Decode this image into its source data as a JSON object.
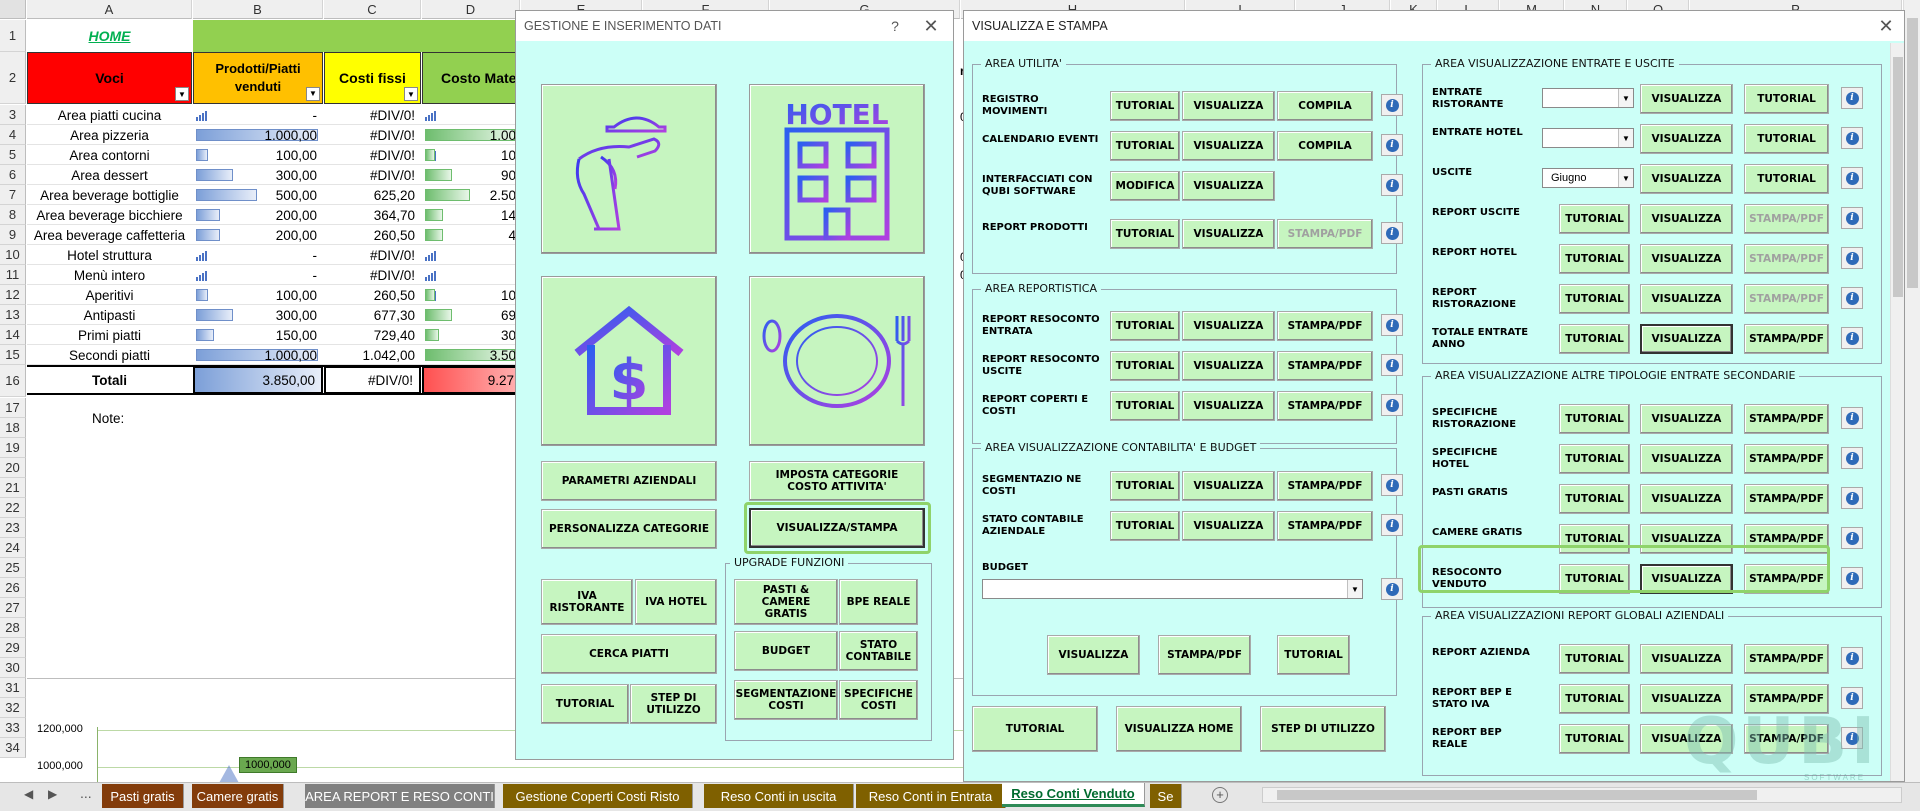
{
  "sheet": {
    "columns": [
      "A",
      "B",
      "C",
      "D",
      "E",
      "F",
      "G",
      "H",
      "I",
      "J",
      "K",
      "L",
      "M",
      "N",
      "O",
      "P"
    ],
    "home_link": "HOME",
    "headers": {
      "voci": "Voci",
      "prodotti": "Prodotti/Piatti venduti",
      "costi_fissi": "Costi fissi",
      "costo_mat": "Costo Mater"
    },
    "rows": [
      {
        "n": "3",
        "voce": "Area piatti cucina",
        "b": "-",
        "c": "#DIV/0!",
        "d": ""
      },
      {
        "n": "4",
        "voce": "Area pizzeria",
        "b": "1.000,00",
        "c": "#DIV/0!",
        "d": "1.00"
      },
      {
        "n": "5",
        "voce": "Area contorni",
        "b": "100,00",
        "c": "#DIV/0!",
        "d": "10"
      },
      {
        "n": "6",
        "voce": "Area dessert",
        "b": "300,00",
        "c": "#DIV/0!",
        "d": "90"
      },
      {
        "n": "7",
        "voce": "Area beverage bottiglie",
        "b": "500,00",
        "c": "625,20",
        "d": "2.50"
      },
      {
        "n": "8",
        "voce": "Area beverage bicchiere",
        "b": "200,00",
        "c": "364,70",
        "d": "14"
      },
      {
        "n": "9",
        "voce": "Area beverage caffetteria",
        "b": "200,00",
        "c": "260,50",
        "d": "4"
      },
      {
        "n": "10",
        "voce": "Hotel struttura",
        "b": "-",
        "c": "#DIV/0!",
        "d": ""
      },
      {
        "n": "11",
        "voce": "Menù intero",
        "b": "-",
        "c": "#DIV/0!",
        "d": ""
      },
      {
        "n": "12",
        "voce": "Aperitivi",
        "b": "100,00",
        "c": "260,50",
        "d": "10"
      },
      {
        "n": "13",
        "voce": "Antipasti",
        "b": "300,00",
        "c": "677,30",
        "d": "69"
      },
      {
        "n": "14",
        "voce": "Primi piatti",
        "b": "150,00",
        "c": "729,40",
        "d": "30"
      },
      {
        "n": "15",
        "voce": "Secondi piatti",
        "b": "1.000,00",
        "c": "1.042,00",
        "d": "3.50"
      }
    ],
    "bar_fractions": [
      0,
      1.0,
      0.1,
      0.3,
      0.5,
      0.2,
      0.2,
      0,
      0,
      0.1,
      0.3,
      0.15,
      1.0
    ],
    "totals": {
      "label": "Totali",
      "b": "3.850,00",
      "c": "#DIV/0!",
      "d": "9.27"
    },
    "note_label": "Note:",
    "chart": {
      "y1": "1200,000",
      "y2": "1000,000",
      "data_label": "1000,000"
    },
    "right_col_fragments": [
      "ri",
      "0!",
      "0!",
      "0!"
    ]
  },
  "gestione": {
    "title": "GESTIONE E INSERIMENTO DATI",
    "help": "?",
    "icons": [
      "waiter-tray-icon",
      "hotel-icon",
      "money-house-icon",
      "plate-cutlery-icon"
    ],
    "hotel_text": "HOTEL",
    "buttons": {
      "parametri": "PARAMETRI AZIENDALI",
      "imposta": "IMPOSTA CATEGORIE COSTO ATTIVITA'",
      "personalizza": "PERSONALIZZA CATEGORIE",
      "visualizza_stampa": "VISUALIZZA/STAMPA",
      "iva_ristorante": "IVA RISTORANTE",
      "iva_hotel": "IVA HOTEL",
      "cerca_piatti": "CERCA PIATTI",
      "tutorial": "TUTORIAL",
      "step": "STEP DI UTILIZZO"
    },
    "upgrade": {
      "title": "UPGRADE FUNZIONI",
      "pasti_camere": "PASTI & CAMERE GRATIS",
      "bpe": "BPE REALE",
      "budget": "BUDGET",
      "stato": "STATO CONTABILE",
      "segmentazione": "SEGMENTAZIONE COSTI",
      "specifiche": "SPECIFICHE COSTI"
    }
  },
  "visualizza": {
    "title": "VISUALIZZA E STAMPA",
    "common": {
      "tutorial": "TUTORIAL",
      "visualizza": "VISUALIZZA",
      "compila": "COMPILA",
      "stampa": "STAMPA/PDF",
      "modifica": "MODIFICA",
      "info": "i"
    },
    "area_utilita": {
      "title": "AREA UTILITA'",
      "rows": [
        "REGISTRO MOVIMENTI",
        "CALENDARIO EVENTI",
        "INTERFACCIATI CON QUBI SOFTWARE",
        "REPORT PRODOTTI"
      ]
    },
    "area_reportistica": {
      "title": "AREA REPORTISTICA",
      "rows": [
        "REPORT RESOCONTO ENTRATA",
        "REPORT RESOCONTO USCITE",
        "REPORT COPERTI E COSTI"
      ]
    },
    "area_contabilita": {
      "title": "AREA VISUALIZZAZIONE CONTABILITA' E BUDGET",
      "rows": [
        "SEGMENTAZIO NE COSTI",
        "STATO CONTABILE AZIENDALE"
      ],
      "budget_label": "BUDGET",
      "budget_value": ""
    },
    "area_entrate": {
      "title": "AREA VISUALIZZAZIONE ENTRATE E USCITE",
      "rows": [
        "ENTRATE RISTORANTE",
        "ENTRATE HOTEL",
        "USCITE",
        "REPORT USCITE",
        "REPORT HOTEL",
        "REPORT RISTORAZIONE",
        "TOTALE ENTRATE ANNO"
      ],
      "combo_values": [
        "",
        "",
        "Giugno"
      ]
    },
    "area_altre": {
      "title": "AREA VISUALIZZAZIONE ALTRE TIPOLOGIE ENTRATE SECONDARIE",
      "rows": [
        "SPECIFICHE RISTORAZIONE",
        "SPECIFICHE HOTEL",
        "PASTI GRATIS",
        "CAMERE GRATIS",
        "RESOCONTO VENDUTO"
      ]
    },
    "area_globali": {
      "title": "AREA VISUALIZZAZIONI REPORT GLOBALI AZIENDALI",
      "rows": [
        "REPORT AZIENDA",
        "REPORT BEP E STATO IVA",
        "REPORT BEP REALE"
      ]
    },
    "bottom": {
      "visualizza_home": "VISUALIZZA HOME",
      "step": "STEP DI UTILIZZO"
    },
    "logo_text": "QUBI",
    "logo_sub": "SOFTWARE"
  },
  "tabs": {
    "more": "...",
    "items": [
      {
        "label": "Pasti gratis",
        "color": "#833c0b"
      },
      {
        "label": "Camere gratis",
        "color": "#833c0b"
      },
      {
        "label": "AREA REPORT E RESO CONTI",
        "color": "#808080"
      },
      {
        "label": "Gestione Coperti Costi Risto",
        "color": "#7f6000"
      },
      {
        "label": "Reso Conti in uscita",
        "color": "#7f6000"
      },
      {
        "label": "Reso Conti in Entrata",
        "color": "#7f6000"
      },
      {
        "label": "Reso Conti Venduto",
        "color": "#ffffff"
      },
      {
        "label": "Se",
        "color": "#7f6000"
      }
    ],
    "add": "+"
  }
}
